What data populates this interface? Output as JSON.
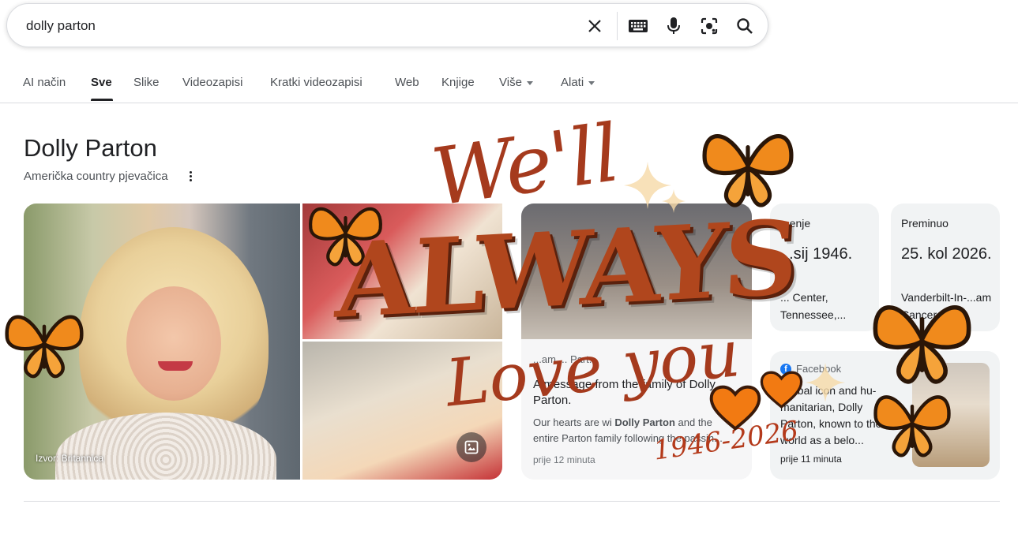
{
  "search": {
    "query": "dolly parton"
  },
  "tabs": [
    {
      "label": "AI način"
    },
    {
      "label": "Sve"
    },
    {
      "label": "Slike"
    },
    {
      "label": "Videozapisi"
    },
    {
      "label": "Kratki videozapisi"
    },
    {
      "label": "Web"
    },
    {
      "label": "Knjige"
    },
    {
      "label": "Više"
    },
    {
      "label": "Alati"
    }
  ],
  "knowledge": {
    "title": "Dolly Parton",
    "subtitle": "Američka country pjevačica",
    "image_source": "Izvor: Britannica"
  },
  "news_card": {
    "source": "...am ... Part...",
    "title": "A message from the family of Dolly Parton.",
    "snippet_a": "Our hearts are wi",
    "snippet_bold": "Dolly Parton",
    "snippet_b": " and the entire Parton family following the passin...",
    "time": "prije 12 minuta"
  },
  "born_card": {
    "label": "...enje",
    "value": "...sij 1946.",
    "place": "... Center, Tennessee,..."
  },
  "died_card": {
    "label": "Preminuo",
    "value": "25. kol 2026.",
    "place": "Vanderbilt-In-...am Cancer..."
  },
  "fb_card": {
    "source": "Facebook",
    "snippet": "Global icon and hu-manitarian, Dolly Parton, known to the world as a belo...",
    "time": "prije 11 minuta"
  },
  "overlay": {
    "line1": "We'll",
    "line2": "ALWAYS",
    "line3": "Love you",
    "years": "1946-2026"
  },
  "colors": {
    "overlay_brown": "#a53a1d",
    "butterfly_orange": "#f08a1c",
    "heart_orange": "#f27a12"
  }
}
